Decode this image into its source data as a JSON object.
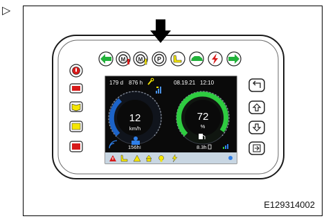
{
  "marker": "▷",
  "figure_id": "E129314002",
  "screen": {
    "days": "179 d",
    "hours": "876 h",
    "date": "08.19.21",
    "time": "12:10",
    "speed_value": "12",
    "speed_unit": "km/h",
    "trip_hours": "156h",
    "fuel_value": "72",
    "fuel_unit": "%",
    "fuel_hours": "8.3h"
  },
  "colors": {
    "green_icon": "#22b13a",
    "red_button": "#d71a1a",
    "yellow_button": "#f5e600",
    "speed_arc": "#1c63c8",
    "fuel_arc": "#2ecc40",
    "screen_bg": "#0a0a0a",
    "alert_bar": "#c8d6e2"
  },
  "icons": {
    "top_row": [
      "arrow-left-icon",
      "engine-warning-icon",
      "engine-warning-2-icon",
      "parking-brake-icon",
      "seat-icon",
      "car-icon",
      "no-charge-icon",
      "arrow-right-icon"
    ],
    "left_column": [
      "warning-circle-icon",
      "battery-icon",
      "book-icon",
      "yellow-square-icon",
      "red-square-icon"
    ],
    "right_column": [
      "return-icon",
      "up-arrow-icon",
      "down-arrow-icon",
      "enter-icon"
    ]
  }
}
